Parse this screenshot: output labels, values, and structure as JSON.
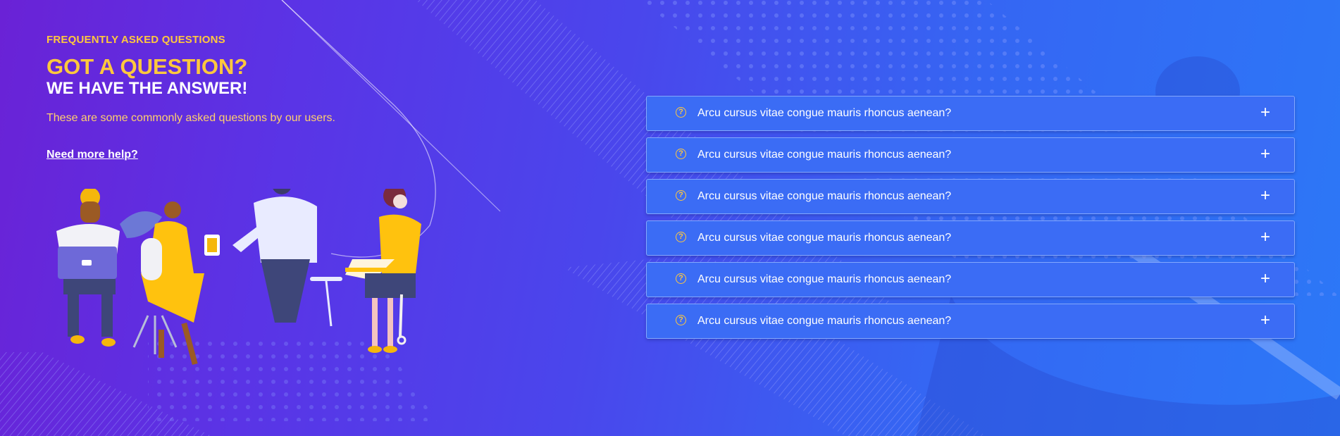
{
  "faq_header": {
    "eyebrow": "FREQUENTLY ASKED QUESTIONS",
    "headline": "GOT A QUESTION?",
    "subheadline": "WE HAVE THE ANSWER!",
    "description": "These are some commonly asked questions by our users.",
    "help_link": "Need more help?"
  },
  "faq_items": [
    {
      "question": "Arcu cursus vitae congue mauris rhoncus aenean?",
      "icon": "question-circle-icon",
      "toggle": "+"
    },
    {
      "question": "Arcu cursus vitae congue mauris rhoncus aenean?",
      "icon": "question-circle-icon",
      "toggle": "+"
    },
    {
      "question": "Arcu cursus vitae congue mauris rhoncus aenean?",
      "icon": "question-circle-icon",
      "toggle": "+"
    },
    {
      "question": "Arcu cursus vitae congue mauris rhoncus aenean?",
      "icon": "question-circle-icon",
      "toggle": "+"
    },
    {
      "question": "Arcu cursus vitae congue mauris rhoncus aenean?",
      "icon": "question-circle-icon",
      "toggle": "+"
    },
    {
      "question": "Arcu cursus vitae congue mauris rhoncus aenean?",
      "icon": "question-circle-icon",
      "toggle": "+"
    }
  ],
  "colors": {
    "accent": "#ffc83d",
    "item_bg": "#3b6cf5",
    "bg_start": "#6a22d6",
    "bg_end": "#2c78f7"
  }
}
